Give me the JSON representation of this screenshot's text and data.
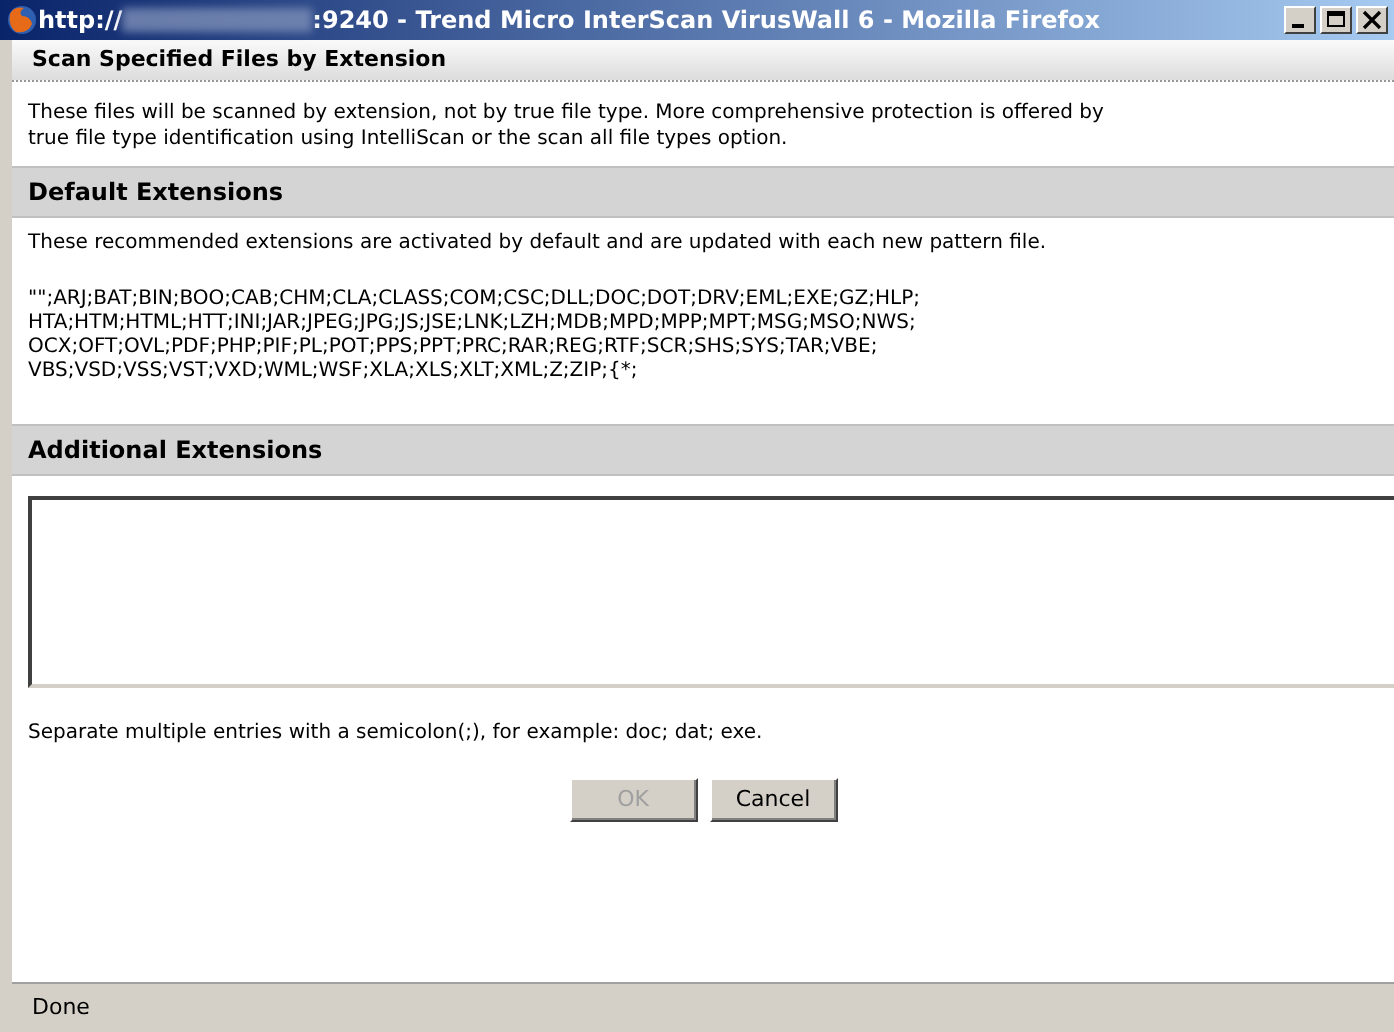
{
  "window": {
    "title_prefix": "http://",
    "title_suffix": ":9240 - Trend Micro InterScan VirusWall 6 - Mozilla Firefox"
  },
  "page_title": "Scan Specified Files by Extension",
  "description": "These files will be scanned by extension, not by true file type. More comprehensive protection is offered by\ntrue file type identification using IntelliScan or the scan all file types option.",
  "sections": [
    {
      "heading": "Default Extensions",
      "kind": "list",
      "note": "These recommended extensions are activated by default and are updated with each new pattern file.",
      "extensions": "\"\";ARJ;BAT;BIN;BOO;CAB;CHM;CLA;CLASS;COM;CSC;DLL;DOC;DOT;DRV;EML;EXE;GZ;HLP;\nHTA;HTM;HTML;HTT;INI;JAR;JPEG;JPG;JS;JSE;LNK;LZH;MDB;MPD;MPP;MPT;MSG;MSO;NWS;\nOCX;OFT;OVL;PDF;PHP;PIF;PL;POT;PPS;PPT;PRC;RAR;REG;RTF;SCR;SHS;SYS;TAR;VBE;\nVBS;VSD;VSS;VST;VXD;WML;WSF;XLA;XLS;XLT;XML;Z;ZIP;{*;"
    },
    {
      "heading": "Additional Extensions",
      "kind": "input",
      "hint": "Separate multiple entries with a semicolon(;), for example: doc; dat; exe."
    }
  ],
  "buttons": [
    {
      "label": "OK",
      "disabled": true
    },
    {
      "label": "Cancel",
      "disabled": false
    }
  ],
  "status_bar": "Done"
}
